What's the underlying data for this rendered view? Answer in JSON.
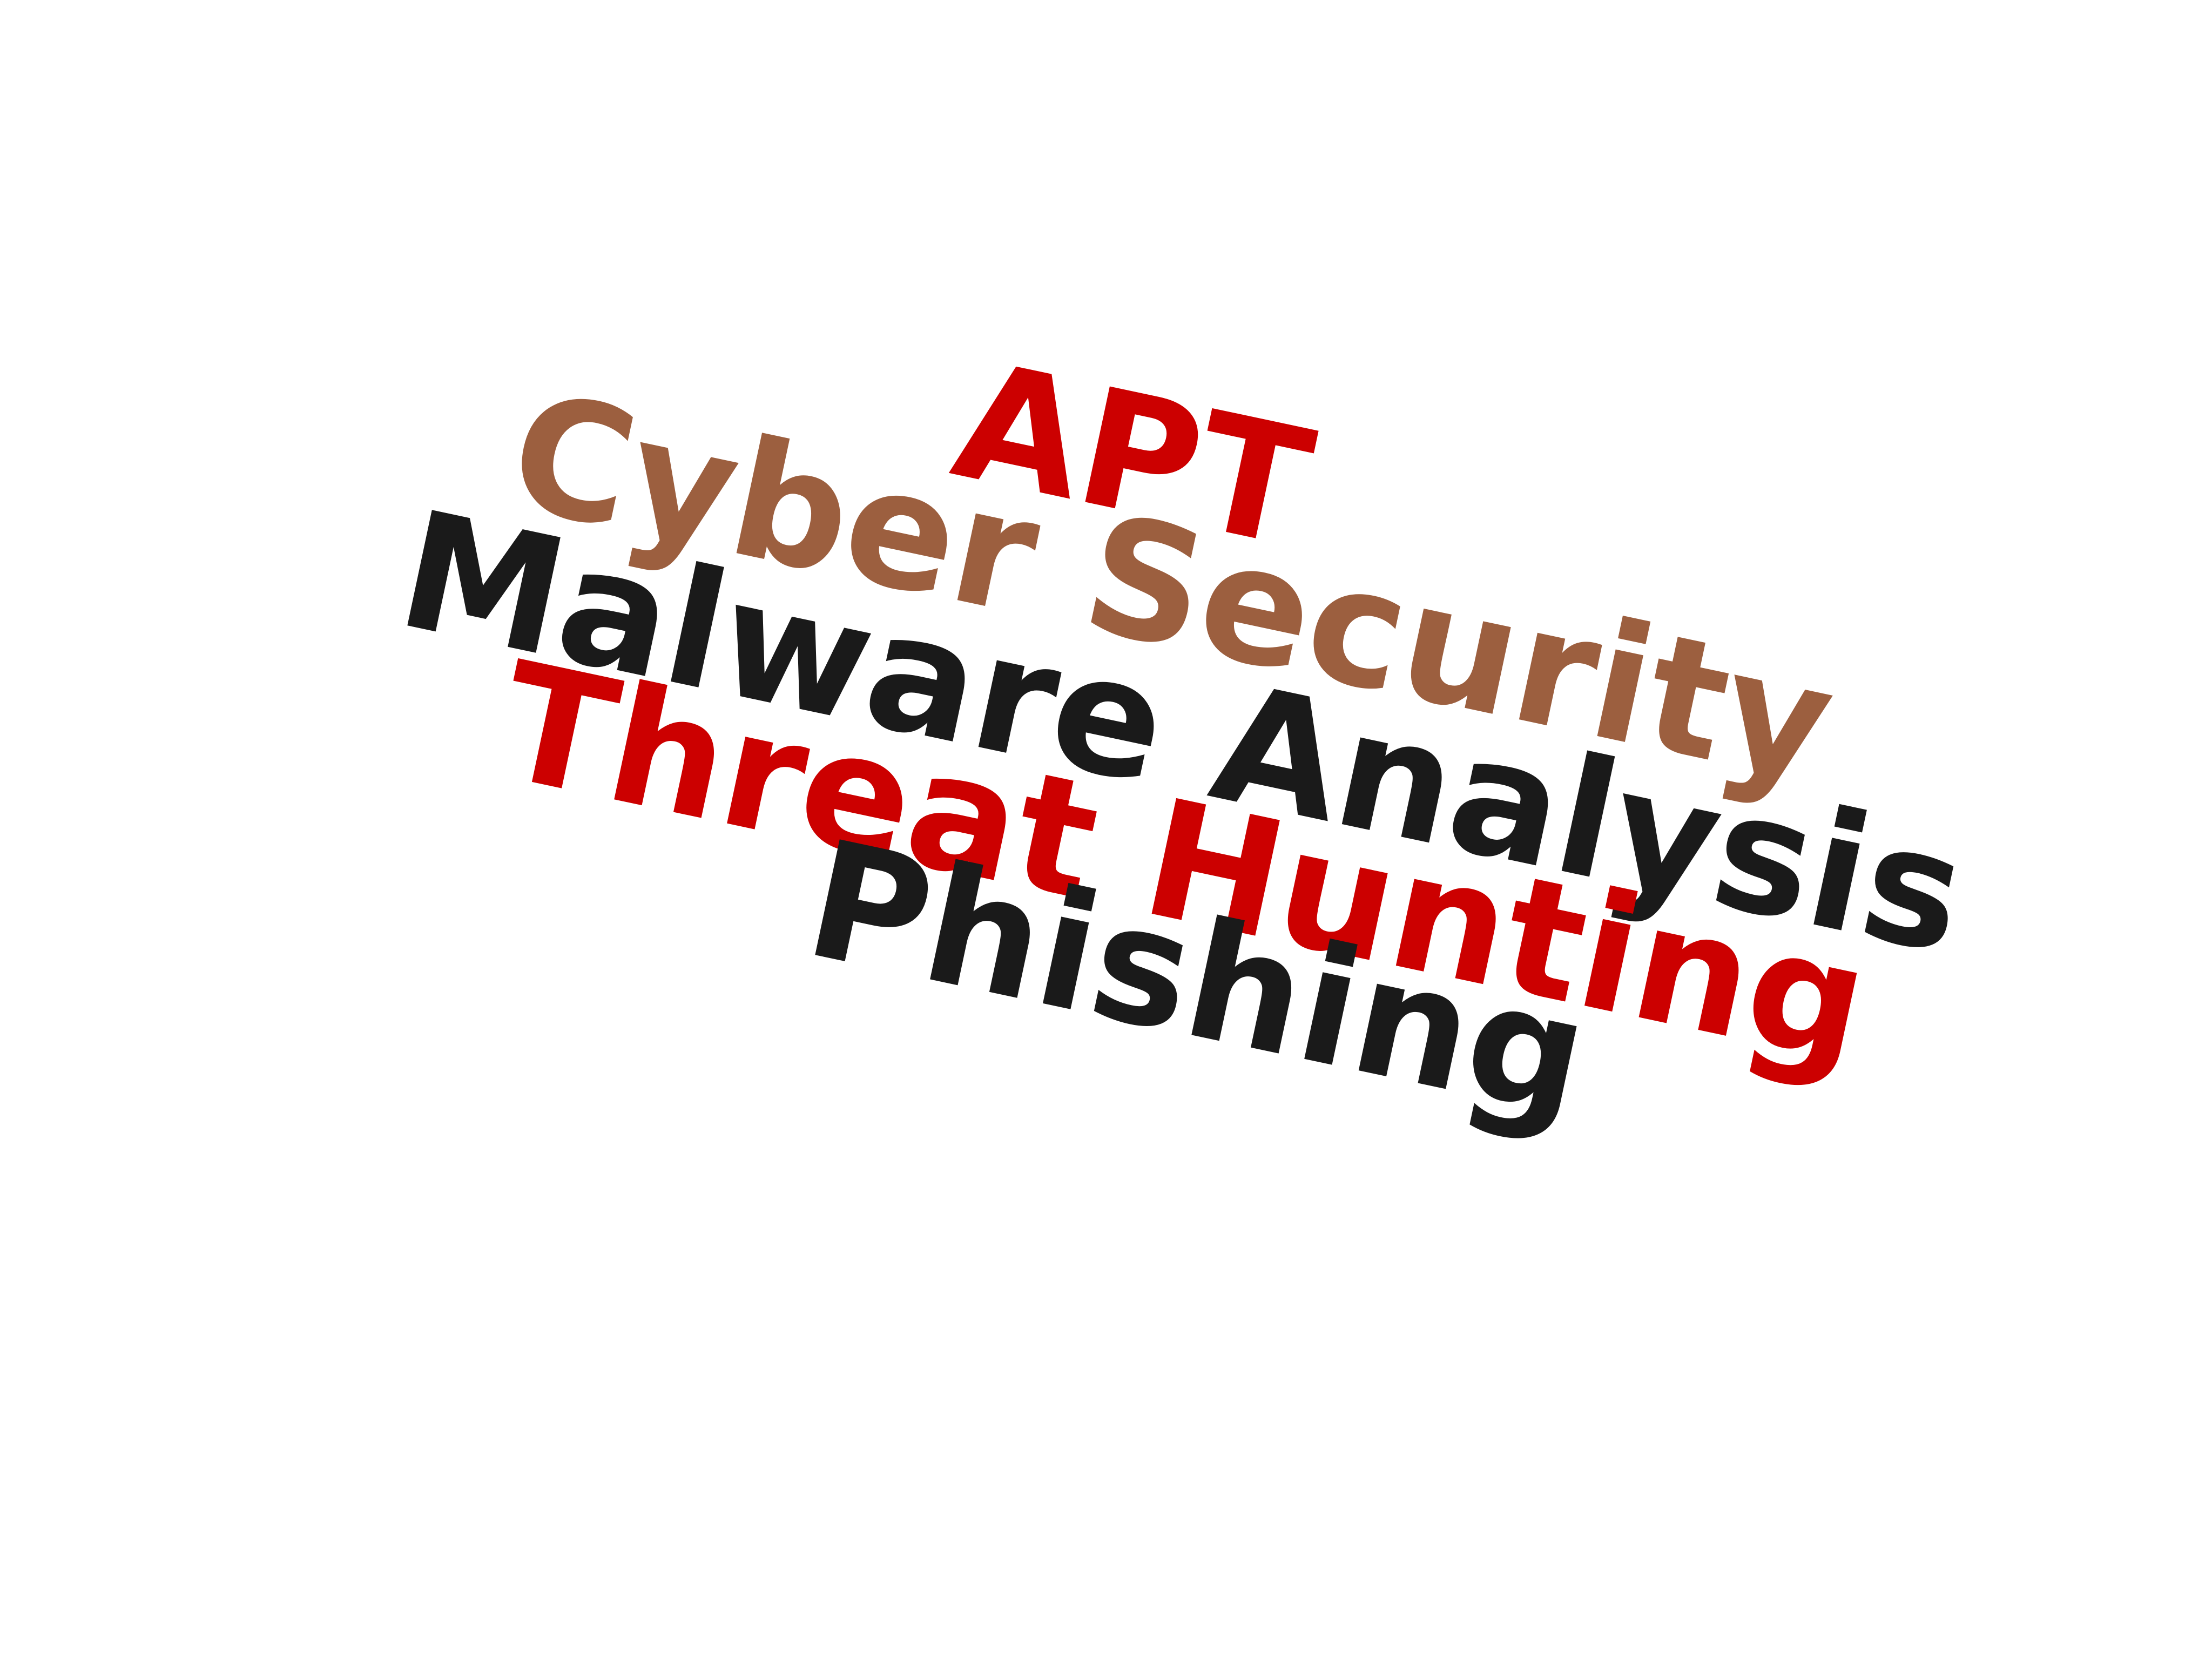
{
  "words": [
    {
      "text": "APT",
      "color": "#cc0000"
    },
    {
      "text": "Cyber Security",
      "color": "#9c5f3f"
    },
    {
      "text": "Malware Analysis",
      "color": "#1a1a1a"
    },
    {
      "text": "Threat Hunting",
      "color": "#cc0000"
    },
    {
      "text": "Phishing",
      "color": "#1a1a1a"
    }
  ]
}
